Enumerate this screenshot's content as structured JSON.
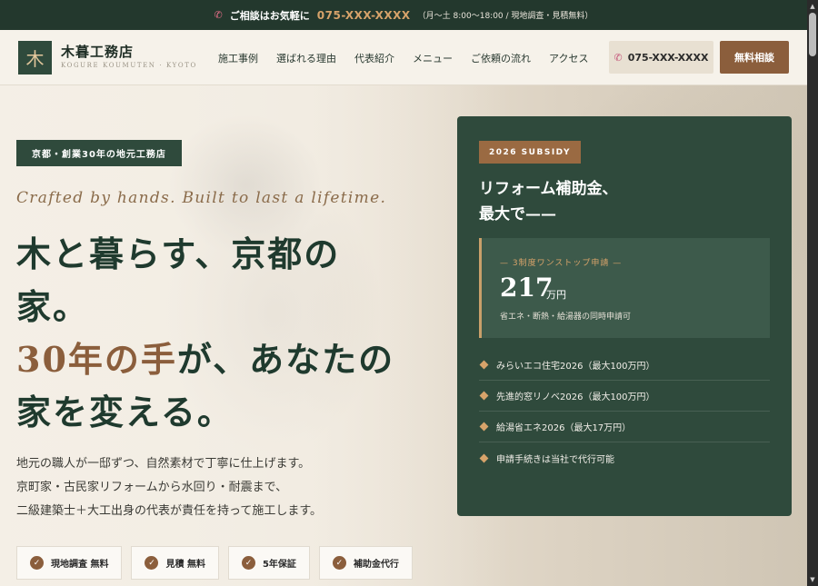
{
  "topbar": {
    "phone_icon": "phone-icon",
    "lead": "ご相談はお気軽に",
    "number": "075-XXX-XXXX",
    "hours": "（月〜土 8:00〜18:00 / 現地調査・見積無料）"
  },
  "header": {
    "logo_mark": "木",
    "logo_name": "木暮工務店",
    "logo_sub": "KOGURE KOUMUTEN · KYOTO",
    "nav": [
      "施工事例",
      "選ばれる理由",
      "代表紹介",
      "メニュー",
      "ご依頼の流れ",
      "アクセス"
    ],
    "phone": "075-XXX-XXXX",
    "cta": "無料相談"
  },
  "hero": {
    "badge": "京都・創業30年の地元工務店",
    "tagline": "Crafted by hands. Built to last a lifetime.",
    "headline_1": "木と暮らす、京都の家。",
    "headline_accent": "30年の手",
    "headline_2": "が、あなたの家を変える。",
    "desc_1": "地元の職人が一邸ずつ、自然素材で丁寧に仕上げます。",
    "desc_2": "京町家・古民家リフォームから水回り・耐震まで、",
    "desc_3": "二級建築士＋大工出身の代表が責任を持って施工します。",
    "chips": [
      "現地調査 無料",
      "見積 無料",
      "5年保証",
      "補助金代行"
    ],
    "check_icon": "check-icon"
  },
  "subsidy": {
    "tag": "2026 SUBSIDY",
    "title_1": "リフォーム補助金、",
    "title_2": "最大で——",
    "box_pre": "— 3制度ワンストップ申請 —",
    "amount": "217",
    "unit": "万円",
    "note": "省エネ・断熱・給湯器の同時申請可",
    "items": [
      "みらいエコ住宅2026（最大100万円）",
      "先進的窓リノベ2026（最大100万円）",
      "給湯省エネ2026（最大17万円）",
      "申請手続きは当社で代行可能"
    ]
  },
  "colors": {
    "dark_green": "#2f4a3c",
    "brown": "#8b5e3c",
    "gold": "#d7a36a",
    "cream": "#f6f2ea"
  }
}
